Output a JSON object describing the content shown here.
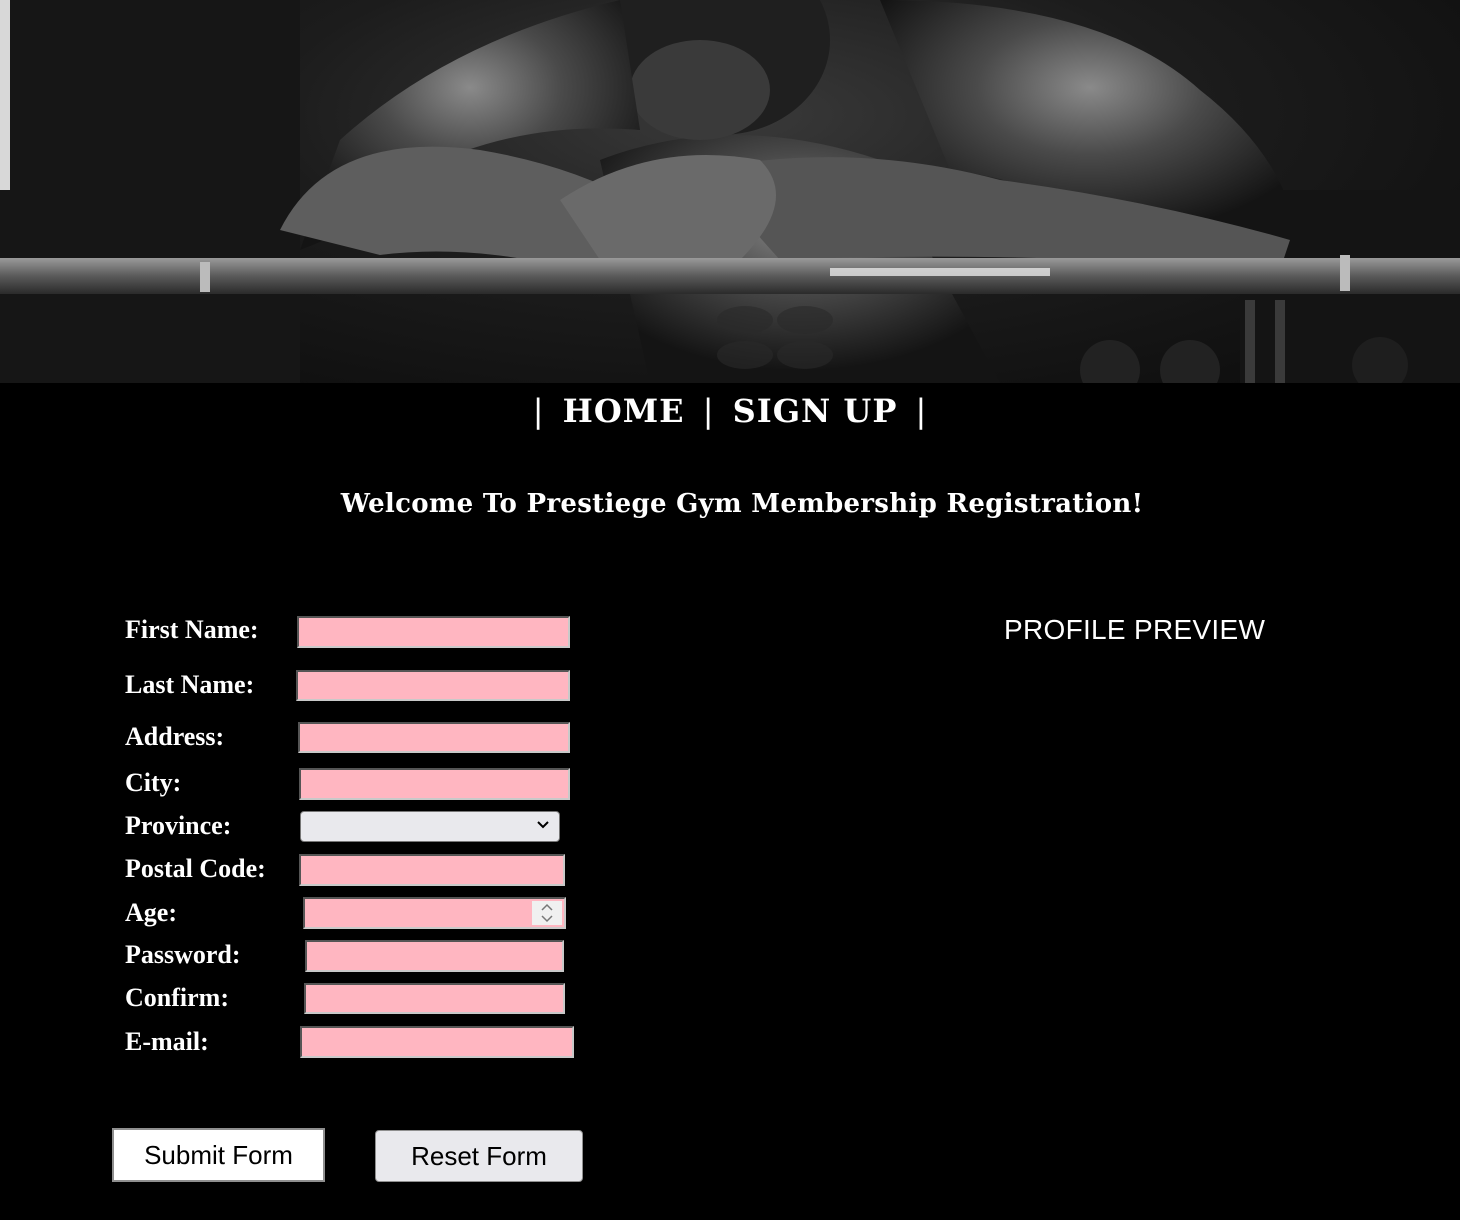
{
  "nav": {
    "separator": "|",
    "home_label": "HOME",
    "signup_label": "SIGN UP"
  },
  "welcome_text": "Welcome To Prestiege Gym Membership Registration!",
  "form": {
    "first_name_label": "First Name:",
    "last_name_label": "Last Name:",
    "address_label": "Address:",
    "city_label": "City:",
    "province_label": "Province:",
    "province_value": "",
    "postal_code_label": "Postal Code:",
    "age_label": "Age:",
    "password_label": "Password:",
    "confirm_label": "Confirm:",
    "email_label": "E-mail:"
  },
  "preview": {
    "title": "PROFILE PREVIEW"
  },
  "buttons": {
    "submit_label": "Submit Form",
    "reset_label": "Reset Form"
  },
  "colors": {
    "page_background": "#000000",
    "input_background": "#ffb6c1",
    "text": "#ffffff"
  },
  "icons": {
    "select_arrow": "chevron-down-icon",
    "number_spinner": "spinner-arrows-icon"
  }
}
